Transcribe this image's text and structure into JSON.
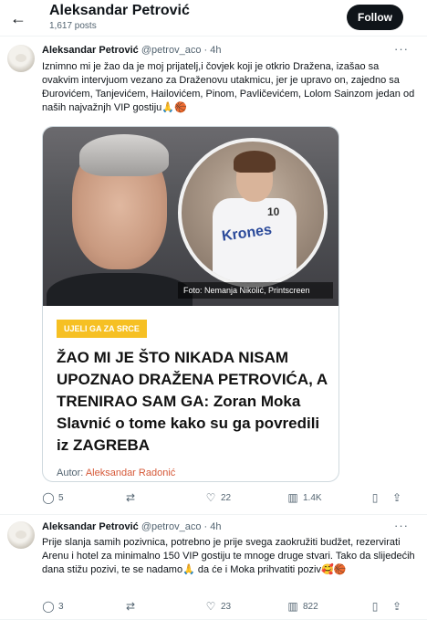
{
  "header": {
    "name": "Aleksandar Petrović",
    "posts": "1,617 posts",
    "follow_label": "Follow"
  },
  "tweet1": {
    "name": "Aleksandar Petrović",
    "handle": "@petrov_aco · 4h",
    "text": "Iznimno mi je žao da je moj prijatelj,i čovjek koji je otkrio Dražena, izašao sa ovakvim intervjuom vezano za Draženovu utakmicu, jer je upravo on, zajedno sa Đurovićem, Tanjevićem, Hailovićem, Pinom, Pavličevićem, Lolom Sainzom jedan od naših najvažnjh VIP gostiju🙏🏀",
    "card": {
      "photo_credit": "Foto: Nemanja Nikolić, Printscreen",
      "jersey_text": "Krones",
      "jersey_number": "10",
      "badge": "UJELI GA ZA SRCE",
      "headline": "ŽAO MI JE ŠTO NIKADA NISAM UPOZNAO DRAŽENA PETROVIĆA, A TRENIRAO SAM GA: Zoran Moka Slavnić o tome kako su ga povredili iz ZAGREBA",
      "author_label": "Autor:",
      "author_name": "Aleksandar Radonić"
    },
    "actions": {
      "replies": "5",
      "retweets": "",
      "likes": "22",
      "views": "1.4K"
    }
  },
  "tweet2": {
    "name": "Aleksandar Petrović",
    "handle": "@petrov_aco · 4h",
    "text": "Prije slanja samih pozivnica, potrebno je prije svega zaokružiti budžet, rezervirati Arenu i hotel za minimalno 150 VIP gostiju te mnoge druge stvari. Tako da slijedećih dana stižu pozivi, te se nadamo🙏 da će i Moka prihvatiti poziv🥰🏀",
    "actions": {
      "replies": "3",
      "retweets": "",
      "likes": "23",
      "views": "822"
    }
  },
  "icons": {
    "back": "←",
    "more": "···",
    "reply": "◯",
    "retweet": "⇄",
    "like": "♡",
    "views": "▥",
    "bookmark": "▯",
    "share": "⇪"
  }
}
